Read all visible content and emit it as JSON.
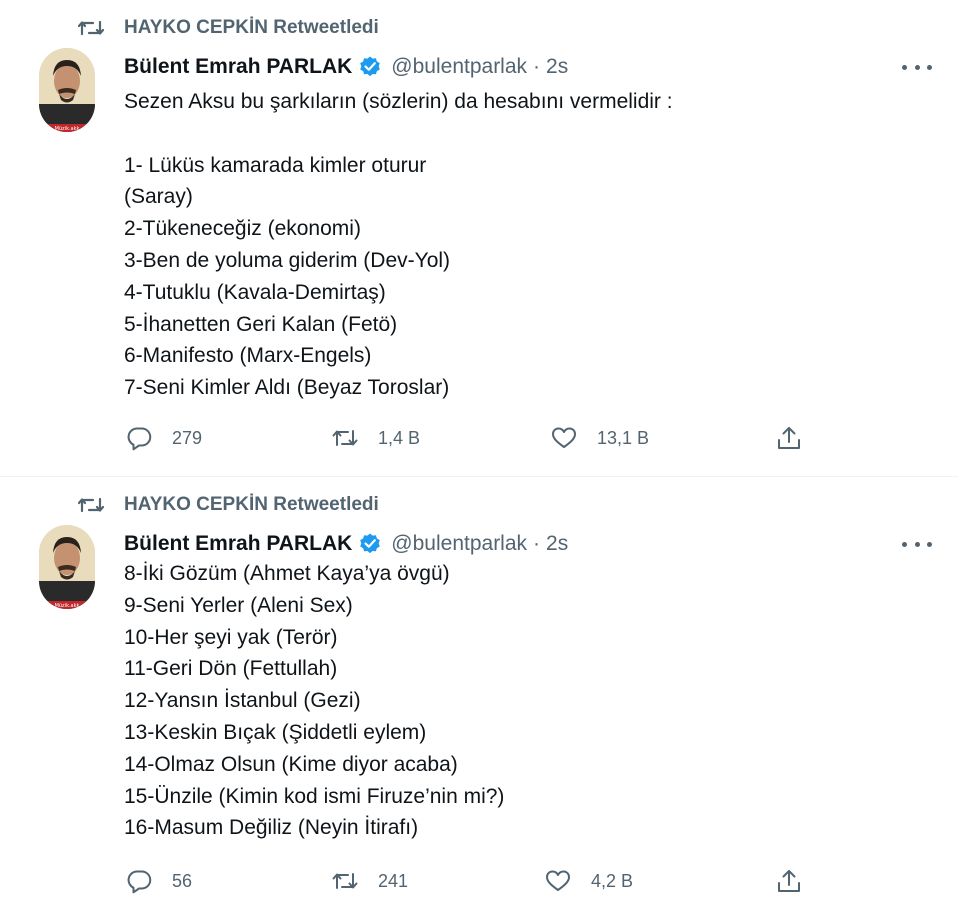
{
  "tweets": [
    {
      "retweet_text": "HAYKO CEPKİN Retweetledi",
      "avatar_caption": "Müzik.akk",
      "name": "Bülent Emrah PARLAK",
      "handle": "@bulentparlak",
      "separator": "·",
      "time": "2s",
      "lines": [
        "Sezen Aksu bu şarkıların (sözlerin) da hesabını vermelidir :",
        "",
        "1- Lüküs kamarada kimler oturur",
        "(Saray)",
        "2-Tükeneceğiz (ekonomi)",
        "3-Ben de yoluma giderim (Dev-Yol)",
        "4-Tutuklu (Kavala-Demirtaş)",
        "5-İhanetten Geri Kalan (Fetö)",
        "6-Manifesto (Marx-Engels)",
        "7-Seni Kimler Aldı (Beyaz Toroslar)"
      ],
      "replies": "279",
      "retweets": "1,4 B",
      "likes": "13,1 B"
    },
    {
      "retweet_text": "HAYKO CEPKİN Retweetledi",
      "avatar_caption": "Müzik.akk",
      "name": "Bülent Emrah PARLAK",
      "handle": "@bulentparlak",
      "separator": "·",
      "time": "2s",
      "lines": [
        "8-İki Gözüm (Ahmet Kaya’ya övgü)",
        "9-Seni Yerler (Aleni Sex)",
        "10-Her şeyi yak (Terör)",
        "11-Geri Dön (Fettullah)",
        "12-Yansın İstanbul (Gezi)",
        "13-Keskin Bıçak (Şiddetli eylem)",
        "14-Olmaz Olsun (Kime diyor acaba)",
        "15-Ünzile (Kimin kod ismi Firuze’nin mi?)",
        "16-Masum Değiliz (Neyin İtirafı)"
      ],
      "replies": "56",
      "retweets": "241",
      "likes": "4,2 B"
    }
  ],
  "colors": {
    "text": "#0f1419",
    "secondary": "#536471",
    "verified": "#1d9bf0",
    "divider": "#eff3f4"
  },
  "icons": [
    "retweet-icon",
    "verified-badge-icon",
    "more-icon",
    "reply-icon",
    "like-icon",
    "share-icon"
  ]
}
